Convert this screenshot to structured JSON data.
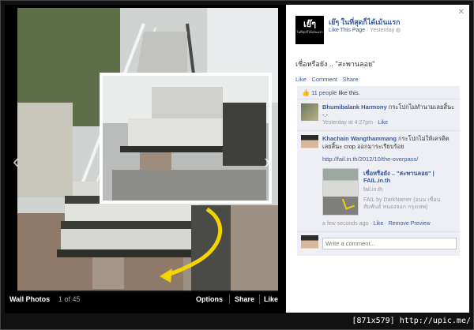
{
  "photo_viewer": {
    "album_label": "Wall Photos",
    "count_label": "1 of 45",
    "options_label": "Options",
    "share_label": "Share",
    "like_label": "Like"
  },
  "post": {
    "page_name": "เย๊ๆ ในที่สุดก็ได้เม้นแรก",
    "like_page_label": "Like This Page",
    "timestamp": "Yesterday",
    "caption": "เชื่อหรือยัง .. \"สะพานลอย\"",
    "avatar_text": "เย๊ๆ",
    "avatar_subtext": "ในที่สุดก็ได้เม้นแรก",
    "actions": {
      "like": "Like",
      "comment": "Comment",
      "share": "Share"
    },
    "likes": {
      "count_text": "11 people",
      "suffix": "like this."
    }
  },
  "comments": [
    {
      "author": "Bhumibalank Harmony",
      "text": "กระโปกไม่ทำนามเลยสิ้นะ -.-",
      "time": "Yesterday at 4:27pm",
      "like": "Like"
    },
    {
      "author": "Khachain Wangthammang",
      "text": "กระโปกไม่ให้เครดิตเลยสิ้นะ crop ออกมาระเรียบร้อย",
      "link_url": "http://fail.in.th/2012/10/the-overpass/",
      "share_title": "เชื่อหรือยัง .. \"สะพานลอย\" | FAIL.in.th",
      "share_domain": "fail.in.th",
      "share_desc": "FAIL by DarkNamer (อนน เขื่อนสัมพันธ์ หนองจอก กรุงเทพ)",
      "time": "a few seconds ago",
      "like": "Like",
      "remove_preview": "Remove Preview"
    }
  ],
  "write_comment_placeholder": "Write a comment...",
  "watermark": "[871x579] http://upic.me/"
}
